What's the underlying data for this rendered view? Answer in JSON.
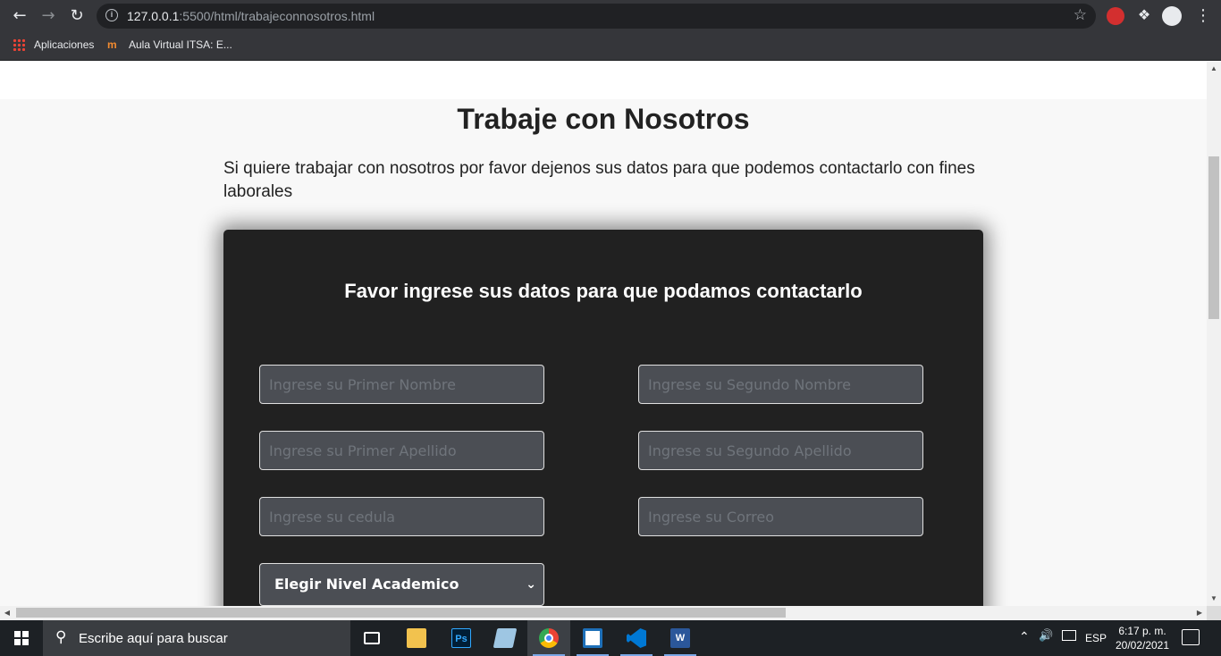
{
  "browser": {
    "url_host": "127.0.0.1",
    "url_path": ":5500/html/trabajeconnosotros.html",
    "bookmarks": [
      {
        "label": "Aplicaciones"
      },
      {
        "label": "Aula Virtual ITSA: E..."
      }
    ]
  },
  "page": {
    "title": "Trabaje con Nosotros",
    "intro": "Si quiere trabajar con nosotros por favor dejenos sus datos para que podemos contactarlo con fines laborales",
    "form": {
      "heading": "Favor ingrese sus datos para que podamos contactarlo",
      "fields": {
        "primer_nombre": "Ingrese su Primer Nombre",
        "segundo_nombre": "Ingrese su Segundo Nombre",
        "primer_apellido": "Ingrese su Primer Apellido",
        "segundo_apellido": "Ingrese su Segundo Apellido",
        "cedula": "Ingrese su cedula",
        "correo": "Ingrese su Correo"
      },
      "nivel_academico": "Elegir Nivel Academico"
    }
  },
  "taskbar": {
    "search_placeholder": "Escribe aquí para buscar",
    "apps": [
      {
        "name": "Task View",
        "icon": "task-view-icon"
      },
      {
        "name": "File Explorer",
        "icon": "folder-icon"
      },
      {
        "name": "Photoshop",
        "icon": "photoshop-icon",
        "label": "Ps"
      },
      {
        "name": "Notepad",
        "icon": "notepad-icon"
      },
      {
        "name": "Chrome",
        "icon": "chrome-icon"
      },
      {
        "name": "App",
        "icon": "app-icon"
      },
      {
        "name": "Visual Studio Code",
        "icon": "vscode-icon"
      },
      {
        "name": "Word",
        "icon": "word-icon",
        "label": "W"
      }
    ],
    "language": "ESP",
    "time": "6:17 p. m.",
    "date": "20/02/2021"
  },
  "colors": {
    "form_bg": "#212121",
    "field_bg": "#4b4e54",
    "chrome_bg": "#35363a",
    "taskbar_bg": "#1d2125"
  }
}
